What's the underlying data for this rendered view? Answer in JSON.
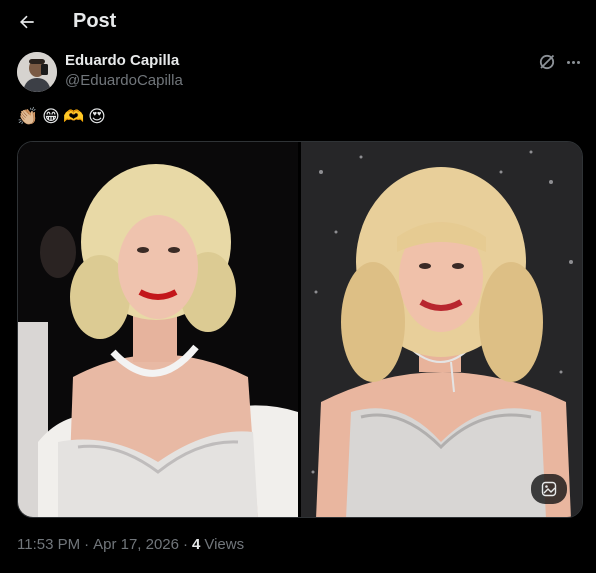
{
  "header": {
    "title": "Post"
  },
  "author": {
    "name": "Eduardo Capilla",
    "handle": "@EduardoCapilla"
  },
  "post": {
    "emojis": [
      "👏🏼",
      "😁",
      "🫶",
      "😍"
    ],
    "time": "11:53 PM",
    "separator1": "·",
    "date": "Apr 17, 2026",
    "separator2": "·",
    "views_count": "4",
    "views_label": "Views"
  },
  "colors": {
    "background": "#000000",
    "text_primary": "#e7e9ea",
    "text_secondary": "#71767b",
    "border": "#2f3336"
  }
}
